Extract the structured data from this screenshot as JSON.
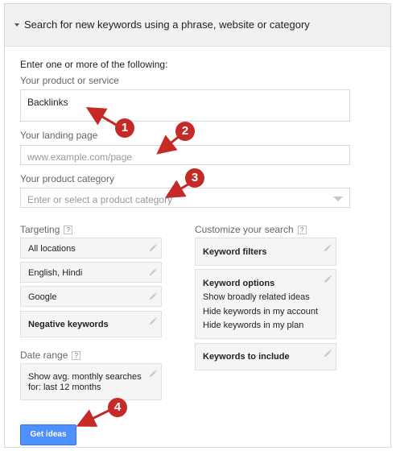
{
  "header": {
    "title": "Search for new keywords using a phrase, website or category"
  },
  "form": {
    "intro": "Enter one or more of the following:",
    "product_label": "Your product or service",
    "product_value": "Backlinks",
    "landing_label": "Your landing page",
    "landing_placeholder": "www.example.com/page",
    "category_label": "Your product category",
    "category_placeholder": "Enter or select a product category"
  },
  "targeting": {
    "label": "Targeting",
    "help": "?",
    "items": [
      "All locations",
      "English, Hindi",
      "Google",
      "Negative keywords"
    ]
  },
  "date_range": {
    "label": "Date range",
    "help": "?",
    "line1": "Show avg. monthly searches",
    "line2": "for: last 12 months"
  },
  "customize": {
    "label": "Customize your search",
    "help": "?",
    "keyword_filters": "Keyword filters",
    "keyword_options": {
      "title": "Keyword options",
      "lines": [
        "Show broadly related ideas",
        "Hide keywords in my account",
        "Hide keywords in my plan"
      ]
    },
    "keywords_to_include": "Keywords to include"
  },
  "button": {
    "get_ideas": "Get ideas"
  },
  "annotations": [
    "1",
    "2",
    "3",
    "4"
  ],
  "colors": {
    "accent_button": "#4d90fe",
    "annotation": "#c62a27"
  }
}
